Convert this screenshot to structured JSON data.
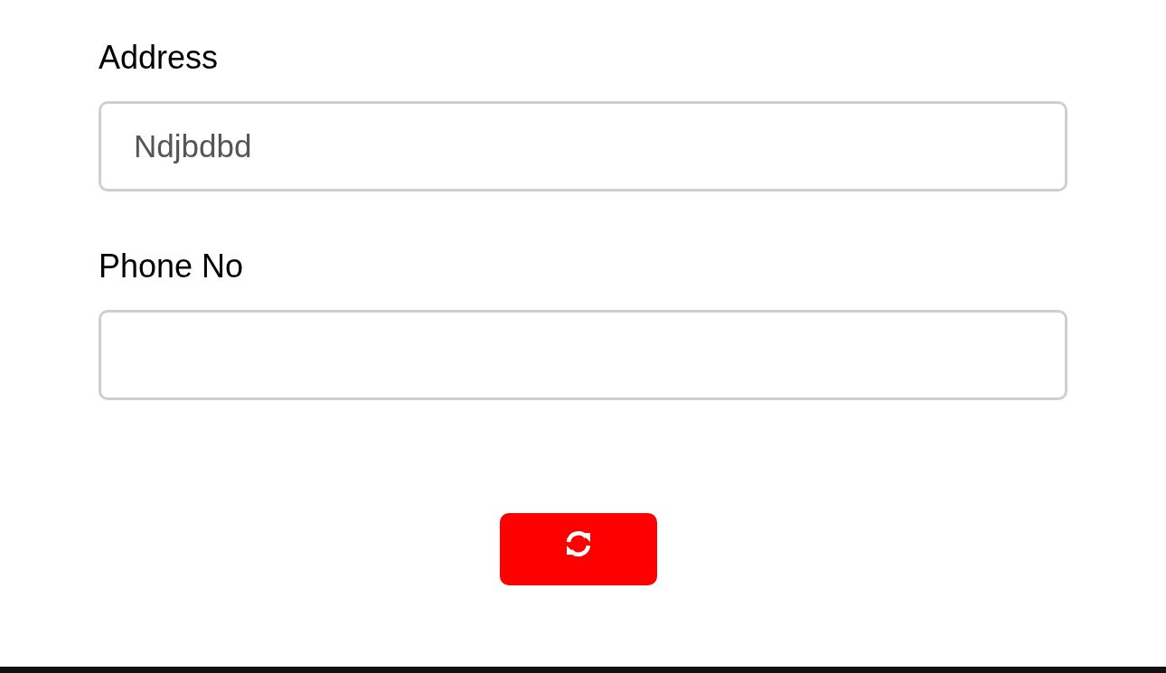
{
  "fields": [
    {
      "label": "Address",
      "value": "Ndjbdbd"
    },
    {
      "label": "Phone No"
    }
  ]
}
